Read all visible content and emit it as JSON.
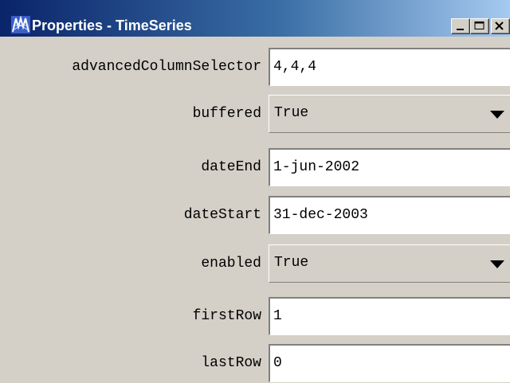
{
  "window": {
    "title": "Properties - TimeSeries",
    "icon": "app-icon"
  },
  "title_buttons": {
    "minimize_icon": "minimize-icon",
    "maximize_icon": "maximize-icon",
    "close_icon": "close-icon"
  },
  "properties": [
    {
      "name": "advancedColumnSelector",
      "value": "4,4,4",
      "type": "text"
    },
    {
      "name": "buffered",
      "value": "True",
      "type": "dropdown"
    },
    {
      "name": "dateEnd",
      "value": "1-jun-2002",
      "type": "text"
    },
    {
      "name": "dateStart",
      "value": "31-dec-2003",
      "type": "text"
    },
    {
      "name": "enabled",
      "value": "True",
      "type": "dropdown"
    },
    {
      "name": "firstRow",
      "value": "1",
      "type": "text"
    },
    {
      "name": "lastRow",
      "value": "0",
      "type": "text"
    }
  ],
  "colors": {
    "title_gradient_start": "#0a246a",
    "title_gradient_end": "#a6caf0",
    "face": "#d4d0c8",
    "field_bg": "#ffffff"
  }
}
